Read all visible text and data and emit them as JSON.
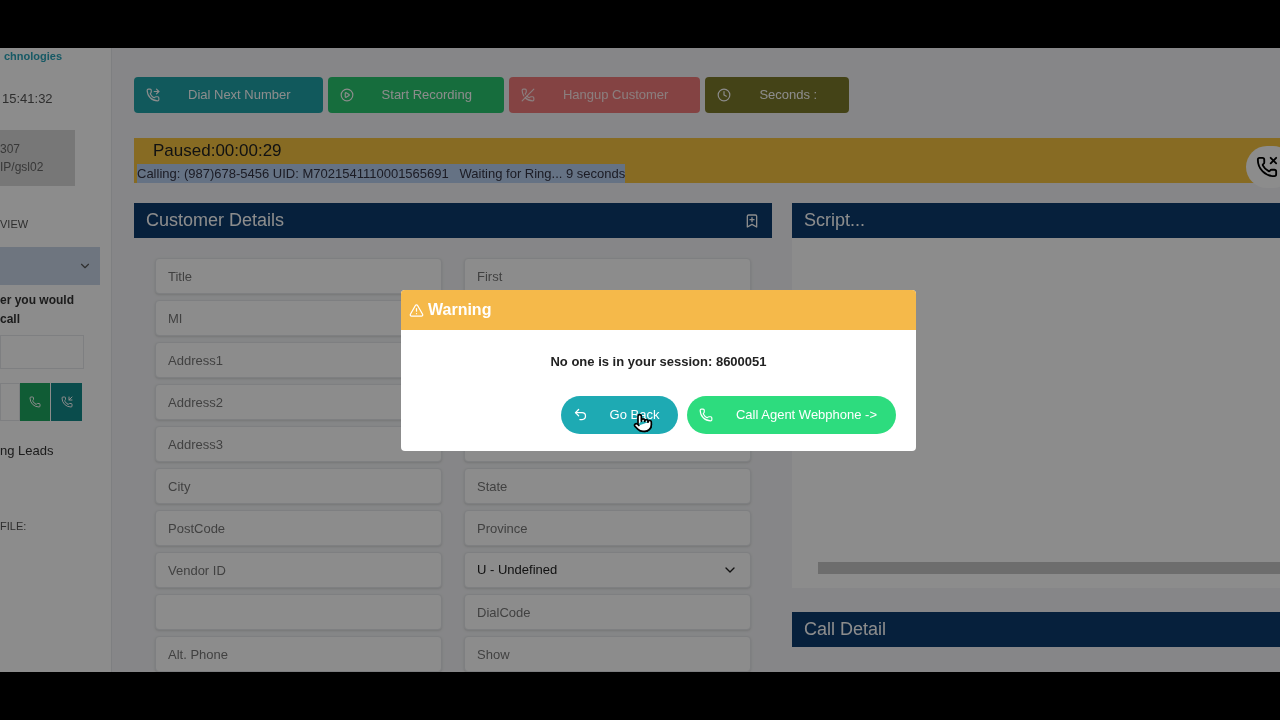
{
  "sidebar": {
    "brand": "chnologies",
    "time": "15:41:32",
    "extension_lines": [
      "307",
      "IP/gsl02"
    ],
    "view_label": "VIEW",
    "prompt_lines": [
      "er you would",
      "call"
    ],
    "leads_label": "ng Leads",
    "file_label": "FILE:"
  },
  "toolbar": [
    {
      "label": "Dial Next Number",
      "kind": "dial"
    },
    {
      "label": "Start Recording",
      "kind": "record"
    },
    {
      "label": "Hangup Customer",
      "kind": "hangup"
    },
    {
      "label": "Seconds :",
      "kind": "seconds"
    }
  ],
  "status": {
    "paused": "Paused:00:00:29",
    "calling": "Calling: (987)678-5456 UID: M7021541110001565691   Waiting for Ring... 9 seconds"
  },
  "customer_details": {
    "title": "Customer Details",
    "rows": [
      [
        {
          "kind": "input",
          "placeholder": "Title"
        },
        {
          "kind": "input",
          "placeholder": "First"
        }
      ],
      [
        {
          "kind": "input",
          "placeholder": "MI"
        }
      ],
      [
        {
          "kind": "input",
          "placeholder": "Address1"
        }
      ],
      [
        {
          "kind": "input",
          "placeholder": "Address2"
        }
      ],
      [
        {
          "kind": "input",
          "placeholder": "Address3"
        },
        {
          "kind": "input"
        }
      ],
      [
        {
          "kind": "input",
          "placeholder": "City"
        },
        {
          "kind": "input",
          "placeholder": "State"
        }
      ],
      [
        {
          "kind": "input",
          "placeholder": "PostCode"
        },
        {
          "kind": "input",
          "placeholder": "Province"
        }
      ],
      [
        {
          "kind": "input",
          "placeholder": "Vendor ID"
        },
        {
          "kind": "select",
          "value": "U - Undefined"
        }
      ],
      [
        {
          "kind": "input"
        },
        {
          "kind": "input",
          "placeholder": "DialCode"
        }
      ],
      [
        {
          "kind": "input",
          "placeholder": "Alt. Phone"
        },
        {
          "kind": "input",
          "placeholder": "Show"
        }
      ]
    ]
  },
  "script": {
    "title": "Script..."
  },
  "call_detail": {
    "title": "Call Detail"
  },
  "dialog": {
    "title": "Warning",
    "message": "No one is in your session: 8600051",
    "buttons": [
      {
        "label": "Go Back",
        "kind": "back"
      },
      {
        "label": "Call Agent Webphone ->",
        "kind": "call"
      }
    ]
  }
}
